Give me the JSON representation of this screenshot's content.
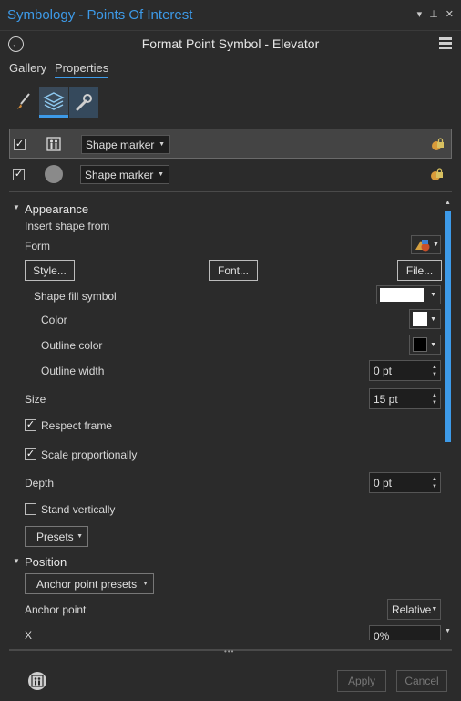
{
  "window": {
    "title": "Symbology - Points Of Interest",
    "controls": [
      "▾",
      "⊥",
      "✕"
    ]
  },
  "header": {
    "title": "Format Point Symbol - Elevator"
  },
  "tabs": [
    {
      "label": "Gallery"
    },
    {
      "label": "Properties"
    }
  ],
  "layers": [
    {
      "checked": true,
      "type": "Shape marker"
    },
    {
      "checked": true,
      "type": "Shape marker"
    }
  ],
  "appearance": {
    "title": "Appearance",
    "insert_shape_from": "Insert shape from",
    "form_label": "Form",
    "style_button": "Style...",
    "font_button": "Font...",
    "file_button": "File...",
    "shape_fill_symbol": "Shape fill symbol",
    "color_label": "Color",
    "outline_color_label": "Outline color",
    "outline_width_label": "Outline width",
    "outline_width_value": "0 pt",
    "size_label": "Size",
    "size_value": "15 pt",
    "respect_frame": "Respect frame",
    "scale_proportionally": "Scale proportionally",
    "depth_label": "Depth",
    "depth_value": "0 pt",
    "stand_vertically": "Stand vertically",
    "presets_button": "Presets",
    "colors": {
      "fill": "#ffffff",
      "color": "#ffffff",
      "outline": "#000000"
    }
  },
  "position": {
    "title": "Position",
    "anchor_presets": "Anchor point presets",
    "anchor_point_label": "Anchor point",
    "anchor_point_value": "Relative",
    "x_label": "X",
    "x_value": "0%"
  },
  "footer": {
    "apply": "Apply",
    "cancel": "Cancel"
  },
  "theme": {
    "accent": "#3d9ae8",
    "bg": "#2b2b2b"
  }
}
